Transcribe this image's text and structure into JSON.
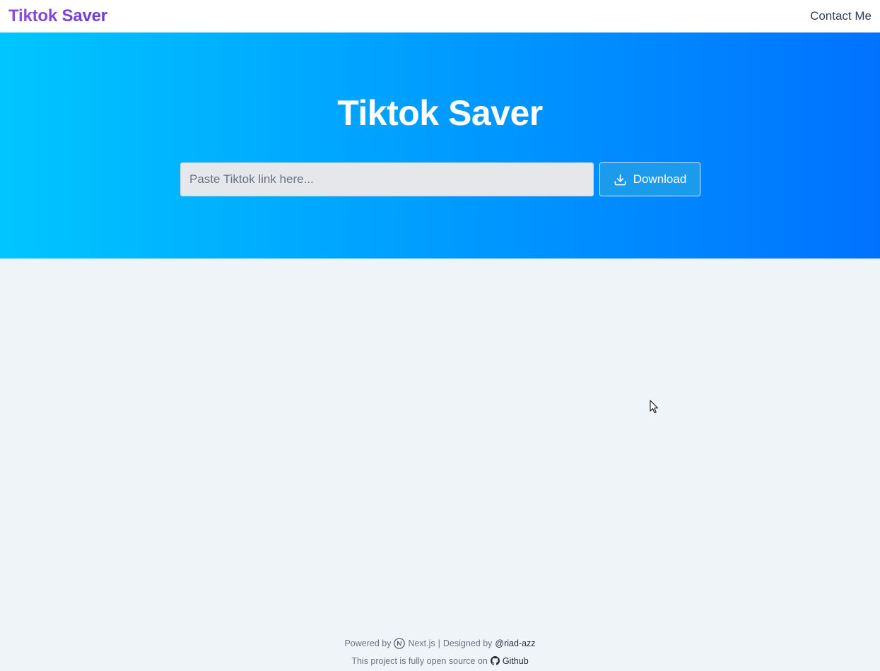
{
  "navbar": {
    "brand": "Tiktok Saver",
    "contact_label": "Contact Me"
  },
  "hero": {
    "title": "Tiktok Saver",
    "input": {
      "placeholder": "Paste Tiktok link here...",
      "value": ""
    },
    "download_label": "Download",
    "download_icon": "download-icon"
  },
  "footer": {
    "powered_prefix": "Powered by",
    "framework": "Next.js",
    "framework_icon": "nextjs-icon",
    "separator": "|",
    "designed_prefix": "Designed by",
    "designer": "@riad-azz",
    "open_source_text": "This project is fully open source on",
    "github_label": "Github",
    "github_icon": "github-icon"
  },
  "colors": {
    "hero_gradient_start": "#00c6ff",
    "hero_gradient_end": "#0072ff",
    "brand_purple": "#7c3aed",
    "button_blue": "#1c9aec",
    "page_background": "#eff4f8"
  }
}
